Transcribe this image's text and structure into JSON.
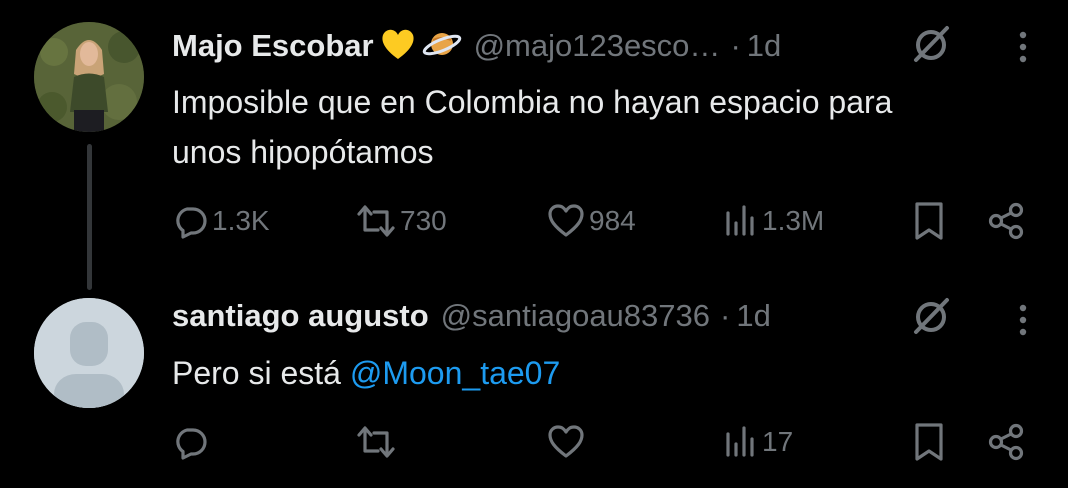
{
  "tweets": [
    {
      "author": {
        "name": "Majo Escobar",
        "handle": "@majo123esco…",
        "badges": [
          "yellow-heart",
          "ringed-planet"
        ]
      },
      "separator": "·",
      "time": "1d",
      "text_lines": [
        "Imposible que en Colombia no hayan espacio para",
        "unos hipopótamos"
      ],
      "metrics": {
        "replies": "1.3K",
        "retweets": "730",
        "likes": "984",
        "views": "1.3M"
      }
    },
    {
      "author": {
        "name": "santiago augusto",
        "handle": "@santiagoau83736"
      },
      "separator": "·",
      "time": "1d",
      "text_prefix": "Pero si está ",
      "mention": "@Moon_tae07",
      "metrics": {
        "replies": "",
        "retweets": "",
        "likes": "",
        "views": "17"
      }
    }
  ],
  "colors": {
    "background": "#000000",
    "text_primary": "#e7e9ea",
    "text_secondary": "#71767b",
    "link": "#1d9bf0",
    "thread_line": "#333639"
  },
  "icons": [
    "reply-icon",
    "retweet-icon",
    "like-icon",
    "views-icon",
    "bookmark-icon",
    "share-icon",
    "grok-icon",
    "more-icon"
  ]
}
